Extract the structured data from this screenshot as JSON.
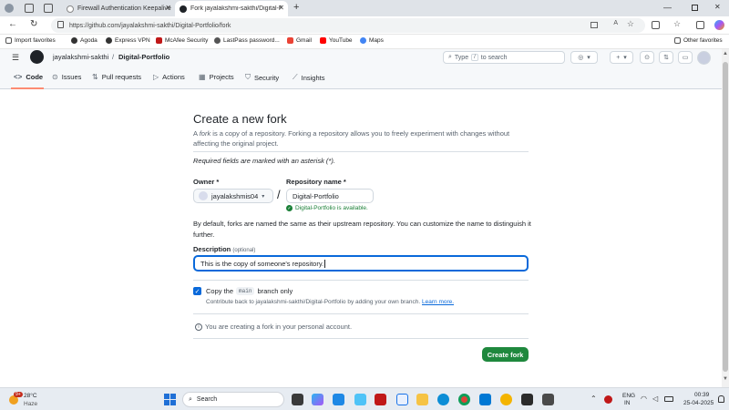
{
  "browser": {
    "tabs": [
      {
        "title": "Firewall Authentication Keepalive"
      },
      {
        "title": "Fork jayalakshmi-sakthi/Digital-Portfolio"
      }
    ],
    "url": "https://github.com/jayalakshmi-sakthi/Digital-Portfolio/fork",
    "bookmarks": [
      "Import favorites",
      "Agoda",
      "Express VPN",
      "McAfee Security",
      "LastPass password...",
      "Gmail",
      "YouTube",
      "Maps"
    ],
    "other_favorites": "Other favorites"
  },
  "github": {
    "owner": "jayalakshmi-sakthi",
    "separator": "/",
    "repo": "Digital-Portfolio",
    "search_placeholder_pre": "Type",
    "search_key": "/",
    "search_placeholder_post": "to search",
    "tabs": [
      "Code",
      "Issues",
      "Pull requests",
      "Actions",
      "Projects",
      "Security",
      "Insights"
    ]
  },
  "form": {
    "title": "Create a new fork",
    "intro_a": "A",
    "intro_fork": "fork",
    "intro_b": "is a copy of a repository. Forking a repository allows you to freely experiment with changes without",
    "intro_c": "affecting the original project.",
    "required_note": "Required fields are marked with an asterisk (*).",
    "owner_label": "Owner *",
    "owner_value": "jayalakshmis04",
    "slash": "/",
    "repo_label": "Repository name *",
    "repo_value": "Digital-Portfolio",
    "available_msg": "Digital-Portfolio is available.",
    "naming_line1": "By default, forks are named the same as their upstream repository. You can customize the name to distinguish it",
    "naming_line2": "further.",
    "desc_label": "Description",
    "desc_optional": "(optional)",
    "desc_value": "This is the copy of someone's repository.",
    "copy_pre": "Copy the",
    "copy_branch": "main",
    "copy_post": "branch only",
    "contribute_text": "Contribute back to jayalakshmi-sakthi/Digital-Portfolio by adding your own branch.",
    "learn_more": "Learn more.",
    "personal_note": "You are creating a fork in your personal account.",
    "create_button": "Create fork"
  },
  "taskbar": {
    "temp": "28°C",
    "weather": "Haze",
    "search": "Search",
    "lang1": "ENG",
    "lang2": "IN",
    "time": "00:39",
    "date": "25-04-2025",
    "badge": "9+"
  },
  "colors": {
    "accent": "#1f883d",
    "link": "#0969da",
    "focus": "#0969da",
    "success": "#1a7f37"
  }
}
